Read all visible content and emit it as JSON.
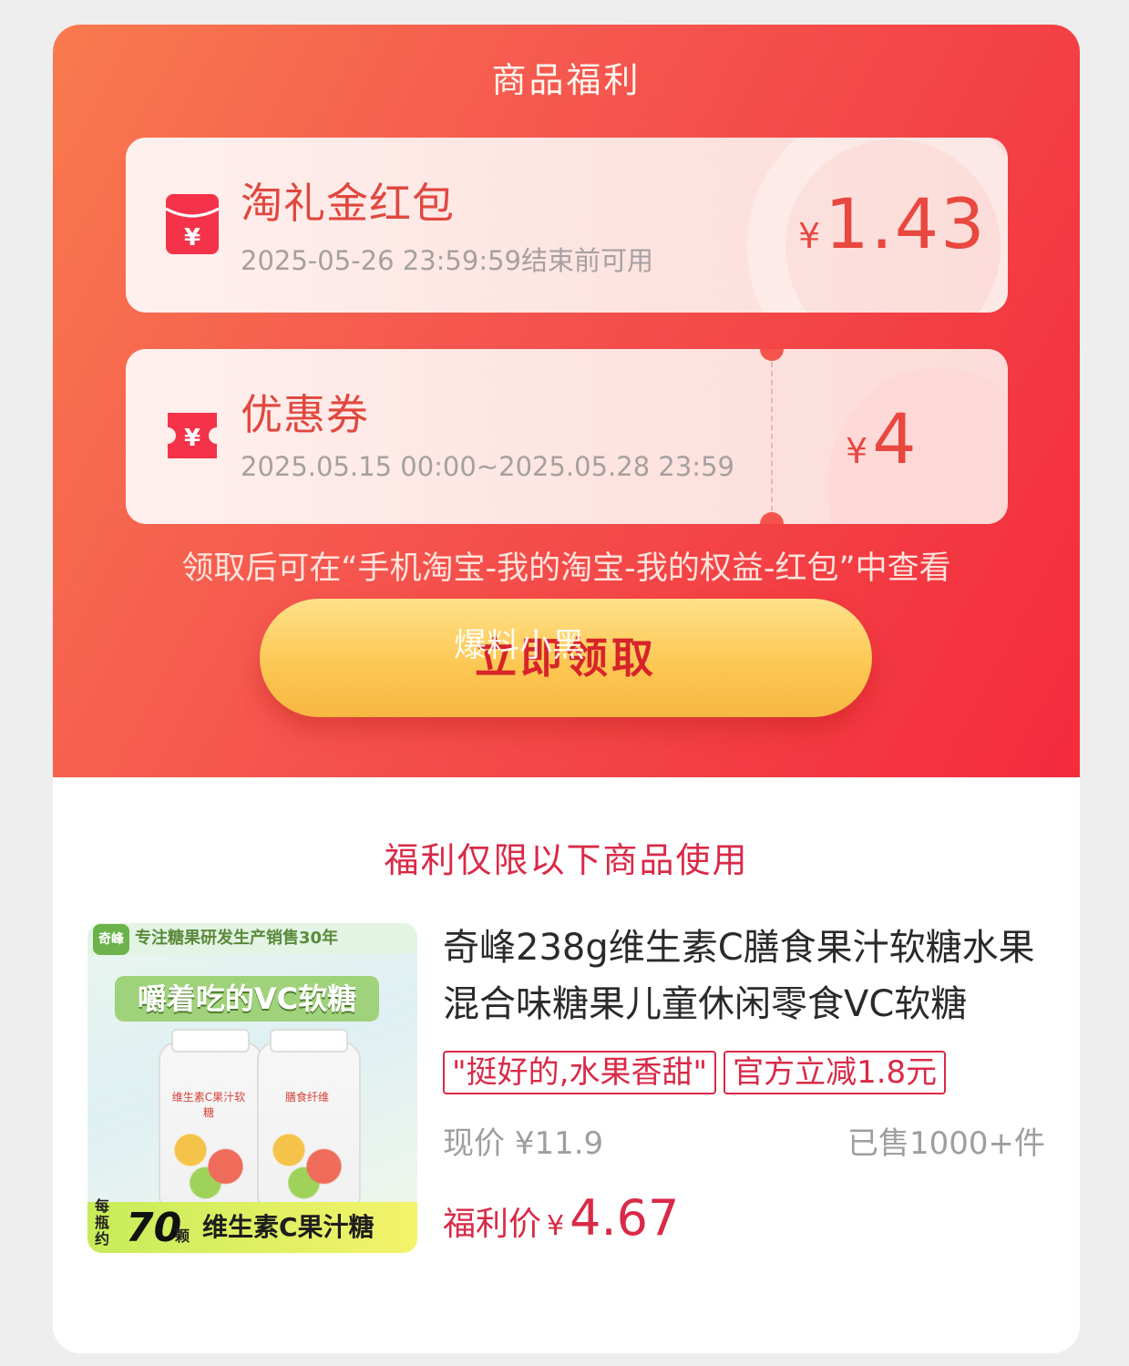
{
  "header": {
    "title": "商品福利"
  },
  "benefits": [
    {
      "name": "淘礼金红包",
      "desc": "2025-05-26 23:59:59结束前可用",
      "currency": "¥",
      "amount": "1.43",
      "icon": "red-envelope-icon"
    },
    {
      "name": "优惠券",
      "desc": "2025.05.15 00:00~2025.05.28 23:59",
      "currency": "¥",
      "amount": "4",
      "icon": "coupon-ticket-icon"
    }
  ],
  "notice": "领取后可在“手机淘宝-我的淘宝-我的权益-红包”中查看",
  "claim_button": {
    "label": "立即领取"
  },
  "watermark": "爆料小黑",
  "products_section": {
    "title": "福利仅限以下商品使用"
  },
  "product": {
    "name": "奇峰238g维生素C膳食果汁软糖水果混合味糖果儿童休闲零食VC软糖",
    "tags": [
      "\"挺好的,水果香甜\"",
      "官方立减1.8元"
    ],
    "current_price_label": "现价",
    "current_price_currency": "¥",
    "current_price": "11.9",
    "sold": "已售1000+件",
    "final_price_label": "福利价",
    "final_price_currency": "¥",
    "final_price": "4.67",
    "thumbnail": {
      "logo": "奇峰",
      "banner": "专注糖果研发生产销售30年",
      "headline": "嚼着吃的VC软糖",
      "jar1_label": "维生素C果汁软糖",
      "jar2_label": "膳食纤维",
      "per_bottle": "每瓶约",
      "count": "70",
      "unit": "颗",
      "tagline": "维生素C果汁糖"
    }
  },
  "colors": {
    "accent": "#f4473f",
    "primary_text": "#e0483f",
    "price_red": "#d92a48",
    "button_gold": "#fcc650"
  }
}
